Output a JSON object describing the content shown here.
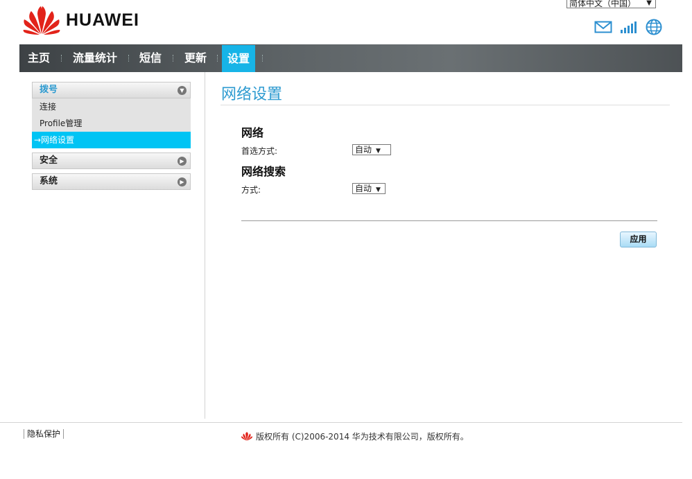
{
  "brand": {
    "name": "HUAWEI",
    "logo_icon": "huawei-logo-icon",
    "logo_color": "#e2231a"
  },
  "language": {
    "selected": "简体中文（中国）",
    "arrow": "▼"
  },
  "status_icons": [
    "mail-icon",
    "signal-icon",
    "globe-icon"
  ],
  "nav": {
    "items": [
      {
        "label": "主页"
      },
      {
        "label": "流量统计"
      },
      {
        "label": "短信"
      },
      {
        "label": "更新"
      },
      {
        "label": "设置",
        "active": true
      }
    ],
    "active_color": "#17b4e7"
  },
  "sidebar": {
    "groups": [
      {
        "label": "拨号",
        "state": "expanded",
        "items": [
          {
            "label": "连接"
          },
          {
            "label": "Profile管理"
          },
          {
            "label": "→网络设置",
            "active": true
          }
        ]
      },
      {
        "label": "安全",
        "state": "collapsed"
      },
      {
        "label": "系统",
        "state": "collapsed"
      }
    ],
    "active_color": "#00c4f4"
  },
  "main": {
    "title": "网络设置",
    "section_network": {
      "title": "网络",
      "preferred_label": "首选方式:",
      "preferred_value": "自动"
    },
    "section_search": {
      "title": "网络搜索",
      "mode_label": "方式:",
      "mode_value": "自动"
    },
    "apply_button": "应用"
  },
  "footer": {
    "privacy": "隐私保护",
    "copyright": "版权所有 (C)2006-2014 华为技术有限公司，版权所有。"
  }
}
